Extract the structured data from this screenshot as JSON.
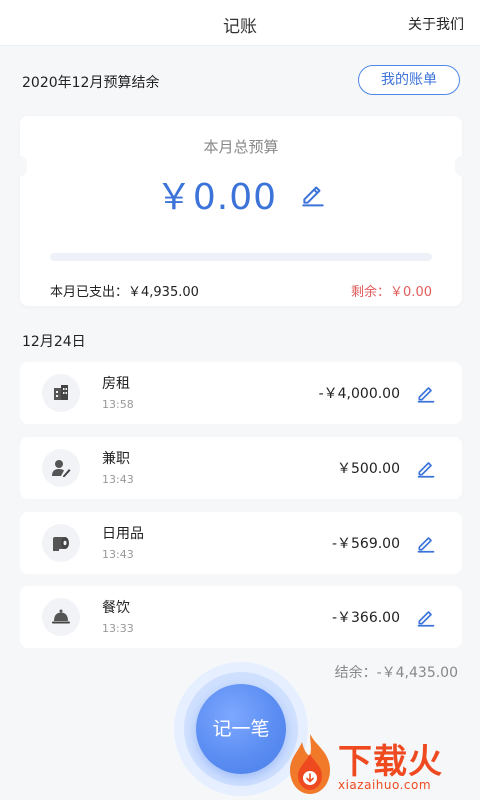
{
  "header": {
    "title": "记账",
    "about": "关于我们"
  },
  "period": {
    "title": "2020年12月预算结余",
    "bill_button": "我的账单"
  },
  "budget": {
    "label": "本月总预算",
    "amount": "￥0.00",
    "progress": 0,
    "spent": "本月已支出：￥4,935.00",
    "remaining": "剩余：￥0.00",
    "accent": "#3b73d9",
    "remaining_color": "#e25c5c"
  },
  "day": {
    "date": "12月24日",
    "transactions": [
      {
        "name": "房租",
        "time": "13:58",
        "amount": "-￥4,000.00",
        "icon": "building-icon"
      },
      {
        "name": "兼职",
        "time": "13:43",
        "amount": "￥500.00",
        "icon": "user-pen-icon"
      },
      {
        "name": "日用品",
        "time": "13:43",
        "amount": "-￥569.00",
        "icon": "toilet-paper-icon"
      },
      {
        "name": "餐饮",
        "time": "13:33",
        "amount": "-￥366.00",
        "icon": "cloche-icon"
      }
    ]
  },
  "balance": "结余：-￥4,435.00",
  "fab_label": "记一笔",
  "watermark": {
    "brand": "下载火",
    "site": "xiazaihuo.com"
  }
}
